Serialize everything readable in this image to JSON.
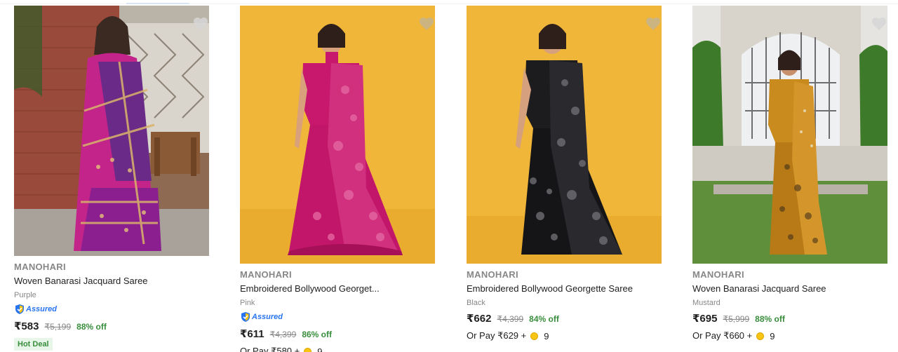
{
  "colors": {
    "brand_gray": "#878787",
    "discount_green": "#388e3c",
    "assured_blue": "#2874f0",
    "coin_gold": "#f9c513",
    "wishlist_heart": "#c8b48a"
  },
  "products": [
    {
      "brand": "MANOHARI",
      "title": "Woven Banarasi Jacquard Saree",
      "color": "Purple",
      "assured_label": "Assured",
      "price": "₹583",
      "mrp": "₹5,199",
      "discount": "88% off",
      "badge": "Hot Deal",
      "image_icon": "saree-photo-purple"
    },
    {
      "brand": "MANOHARI",
      "title": "Embroidered Bollywood Georget...",
      "color": "Pink",
      "assured_label": "Assured",
      "price": "₹611",
      "mrp": "₹4,399",
      "discount": "86% off",
      "pay_text": "Or Pay ₹580 +",
      "coins": "9",
      "image_icon": "saree-photo-pink"
    },
    {
      "brand": "MANOHARI",
      "title": "Embroidered Bollywood Georgette Saree",
      "color": "Black",
      "price": "₹662",
      "mrp": "₹4,399",
      "discount": "84% off",
      "pay_text": "Or Pay ₹629 +",
      "coins": "9",
      "image_icon": "saree-photo-black"
    },
    {
      "brand": "MANOHARI",
      "title": "Woven Banarasi Jacquard Saree",
      "color": "Mustard",
      "price": "₹695",
      "mrp": "₹5,999",
      "discount": "88% off",
      "pay_text": "Or Pay ₹660 +",
      "coins": "9",
      "image_icon": "saree-photo-mustard"
    }
  ]
}
